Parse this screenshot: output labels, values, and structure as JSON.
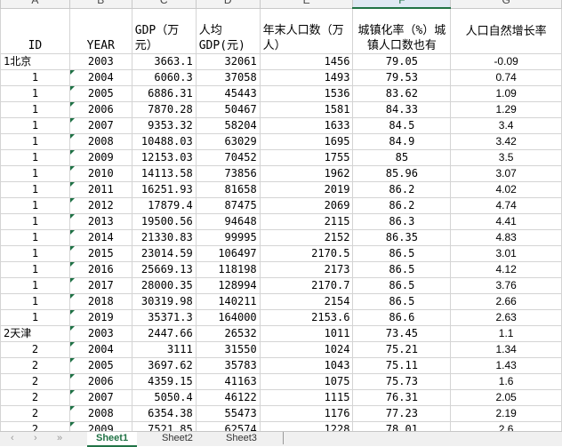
{
  "columns": [
    "A",
    "B",
    "C",
    "D",
    "E",
    "F",
    "G"
  ],
  "headers": [
    "ID",
    "YEAR",
    "GDP（万元）",
    "人均GDP(元)",
    "年末人口数（万人）",
    "城镇化率（%）城镇人口数也有",
    "人口自然增长率"
  ],
  "rows": [
    [
      "1北京",
      "2003",
      "3663.1",
      "32061",
      "1456",
      "79.05",
      "-0.09"
    ],
    [
      "1",
      "2004",
      "6060.3",
      "37058",
      "1493",
      "79.53",
      "0.74"
    ],
    [
      "1",
      "2005",
      "6886.31",
      "45443",
      "1536",
      "83.62",
      "1.09"
    ],
    [
      "1",
      "2006",
      "7870.28",
      "50467",
      "1581",
      "84.33",
      "1.29"
    ],
    [
      "1",
      "2007",
      "9353.32",
      "58204",
      "1633",
      "84.5",
      "3.4"
    ],
    [
      "1",
      "2008",
      "10488.03",
      "63029",
      "1695",
      "84.9",
      "3.42"
    ],
    [
      "1",
      "2009",
      "12153.03",
      "70452",
      "1755",
      "85",
      "3.5"
    ],
    [
      "1",
      "2010",
      "14113.58",
      "73856",
      "1962",
      "85.96",
      "3.07"
    ],
    [
      "1",
      "2011",
      "16251.93",
      "81658",
      "2019",
      "86.2",
      "4.02"
    ],
    [
      "1",
      "2012",
      "17879.4",
      "87475",
      "2069",
      "86.2",
      "4.74"
    ],
    [
      "1",
      "2013",
      "19500.56",
      "94648",
      "2115",
      "86.3",
      "4.41"
    ],
    [
      "1",
      "2014",
      "21330.83",
      "99995",
      "2152",
      "86.35",
      "4.83"
    ],
    [
      "1",
      "2015",
      "23014.59",
      "106497",
      "2170.5",
      "86.5",
      "3.01"
    ],
    [
      "1",
      "2016",
      "25669.13",
      "118198",
      "2173",
      "86.5",
      "4.12"
    ],
    [
      "1",
      "2017",
      "28000.35",
      "128994",
      "2170.7",
      "86.5",
      "3.76"
    ],
    [
      "1",
      "2018",
      "30319.98",
      "140211",
      "2154",
      "86.5",
      "2.66"
    ],
    [
      "1",
      "2019",
      "35371.3",
      "164000",
      "2153.6",
      "86.6",
      "2.63"
    ],
    [
      "2天津",
      "2003",
      "2447.66",
      "26532",
      "1011",
      "73.45",
      "1.1"
    ],
    [
      "2",
      "2004",
      "3111",
      "31550",
      "1024",
      "75.21",
      "1.34"
    ],
    [
      "2",
      "2005",
      "3697.62",
      "35783",
      "1043",
      "75.11",
      "1.43"
    ],
    [
      "2",
      "2006",
      "4359.15",
      "41163",
      "1075",
      "75.73",
      "1.6"
    ],
    [
      "2",
      "2007",
      "5050.4",
      "46122",
      "1115",
      "76.31",
      "2.05"
    ],
    [
      "2",
      "2008",
      "6354.38",
      "55473",
      "1176",
      "77.23",
      "2.19"
    ],
    [
      "2",
      "2009",
      "7521.85",
      "62574",
      "1228",
      "78.01",
      "2.6"
    ]
  ],
  "tabs": [
    "Sheet1",
    "Sheet2",
    "Sheet3"
  ],
  "nav": [
    "‹",
    "›",
    "»"
  ],
  "accent": "#217346"
}
